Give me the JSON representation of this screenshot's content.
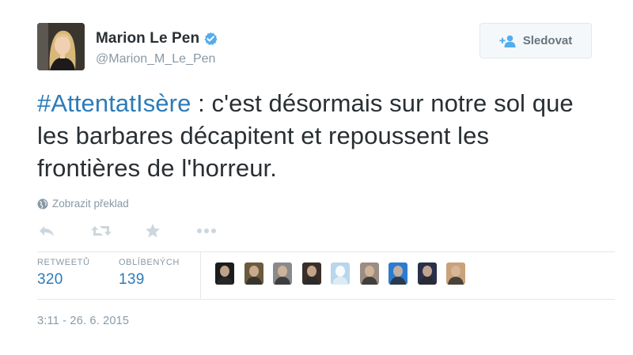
{
  "user": {
    "name": "Marion Le Pen",
    "handle": "@Marion_M_Le_Pen",
    "verified": true
  },
  "follow_button": {
    "label": "Sledovat",
    "icon": "add-user-icon"
  },
  "tweet": {
    "hashtag": "#AttentatIsère",
    "text": " : c'est désormais sur notre sol que les barbares décapitent et repoussent les frontières de l'horreur."
  },
  "translate": {
    "label": "Zobrazit překlad",
    "icon": "globe-icon"
  },
  "actions": [
    {
      "name": "reply",
      "icon": "reply-icon"
    },
    {
      "name": "retweet",
      "icon": "retweet-icon"
    },
    {
      "name": "favorite",
      "icon": "star-icon"
    },
    {
      "name": "more",
      "icon": "more-icon"
    }
  ],
  "stats": {
    "retweets": {
      "label": "RETWEETŮ",
      "value": "320"
    },
    "favorites": {
      "label": "OBLÍBENÝCH",
      "value": "139"
    }
  },
  "favoriters": [
    {
      "icon": "user-avatar-1",
      "color": "#1c1c1c"
    },
    {
      "icon": "user-avatar-2",
      "color": "#6b5a3e"
    },
    {
      "icon": "user-avatar-3",
      "color": "#8a8a8a"
    },
    {
      "icon": "user-avatar-4",
      "color": "#3a2f28"
    },
    {
      "icon": "user-avatar-5",
      "color": "#b9d6ec"
    },
    {
      "icon": "user-avatar-6",
      "color": "#9a8d84"
    },
    {
      "icon": "user-avatar-7",
      "color": "#2d7bd0"
    },
    {
      "icon": "user-avatar-8",
      "color": "#2b2f4a"
    },
    {
      "icon": "user-avatar-9",
      "color": "#c9a27a"
    }
  ],
  "timestamp": "3:11 - 26. 6. 2015",
  "colors": {
    "link": "#2b7bb9",
    "muted": "#8899a6",
    "text": "#292f33",
    "border": "#e1e8ed",
    "verified": "#55acee"
  }
}
